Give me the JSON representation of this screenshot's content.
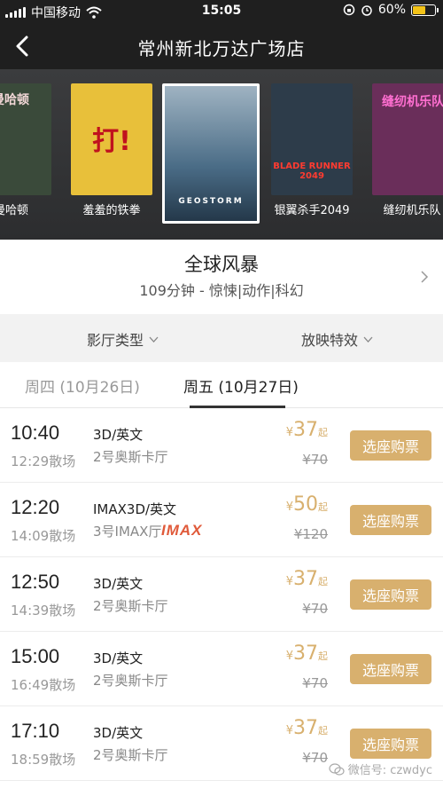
{
  "status_bar": {
    "carrier": "中国移动",
    "time": "15:05",
    "battery": "60%",
    "battery_level": 0.6,
    "icons": [
      "signal-icon",
      "wifi-icon",
      "lock-rotation-icon",
      "alarm-icon",
      "battery-icon"
    ]
  },
  "navbar": {
    "title": "常州新北万达广场店",
    "back_icon": "chevron-left-icon"
  },
  "posters": [
    {
      "name": "遇曼哈顿",
      "art_text": "曼哈顿",
      "color": "#3a4a3a"
    },
    {
      "name": "羞羞的铁拳",
      "art_text": "打!",
      "color": "#e8c03a"
    },
    {
      "name": "",
      "art_text": "GEOSTORM",
      "color": "#4a6c86",
      "selected": true
    },
    {
      "name": "银翼杀手2049",
      "art_text": "BLADE RUNNER 2049",
      "color": "#2d3c4a"
    },
    {
      "name": "缝纫机乐队",
      "art_text": "缝纫机乐队",
      "color": "#6a2e5a"
    }
  ],
  "movie": {
    "title": "全球风暴",
    "meta": "109分钟 - 惊悚|动作|科幻"
  },
  "filters": {
    "hall_type": "影厅类型",
    "effects": "放映特效"
  },
  "date_tabs": [
    {
      "label": "周四 (10月26日)",
      "active": false
    },
    {
      "label": "周五 (10月27日)",
      "active": true
    }
  ],
  "showtimes": [
    {
      "start": "10:40",
      "end": "12:29散场",
      "format": "3D/英文",
      "hall": "2号奥斯卡厅",
      "price_currency": "¥",
      "price": "37",
      "price_suffix": "起",
      "original_price": "¥70",
      "button": "选座购票"
    },
    {
      "start": "12:20",
      "end": "14:09散场",
      "format": "IMAX3D/英文",
      "hall": "3号IMAX厅",
      "badge": "IMAX",
      "price_currency": "¥",
      "price": "50",
      "price_suffix": "起",
      "original_price": "¥120",
      "button": "选座购票"
    },
    {
      "start": "12:50",
      "end": "14:39散场",
      "format": "3D/英文",
      "hall": "2号奥斯卡厅",
      "price_currency": "¥",
      "price": "37",
      "price_suffix": "起",
      "original_price": "¥70",
      "button": "选座购票"
    },
    {
      "start": "15:00",
      "end": "16:49散场",
      "format": "3D/英文",
      "hall": "2号奥斯卡厅",
      "price_currency": "¥",
      "price": "37",
      "price_suffix": "起",
      "original_price": "¥70",
      "button": "选座购票"
    },
    {
      "start": "17:10",
      "end": "18:59散场",
      "format": "3D/英文",
      "hall": "2号奥斯卡厅",
      "price_currency": "¥",
      "price": "37",
      "price_suffix": "起",
      "original_price": "¥70",
      "button": "选座购票"
    }
  ],
  "watermark": "微信号: czwdyc",
  "colors": {
    "accent_gold": "#d8b06e",
    "imax_red": "#e05a3a",
    "header_bg": "#1f1f1f"
  }
}
